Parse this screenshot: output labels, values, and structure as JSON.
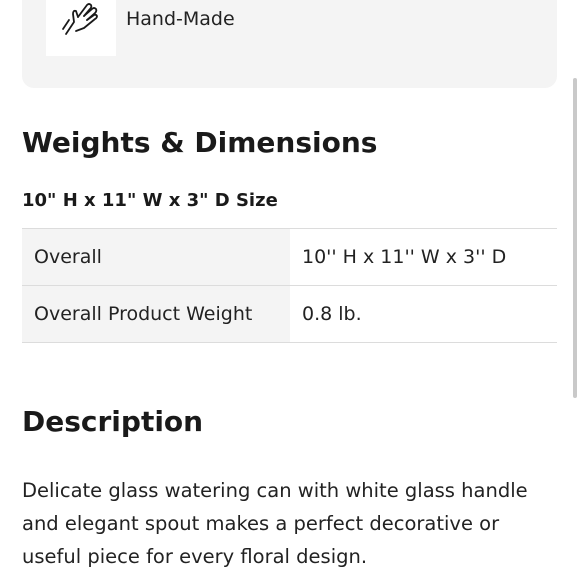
{
  "feature": {
    "icon": "hand-icon",
    "label": "Hand-Made"
  },
  "weights_dimensions": {
    "title": "Weights & Dimensions",
    "size_line": "10\" H x 11\" W x 3\" D Size",
    "rows": [
      {
        "key": "Overall",
        "value": "10'' H x 11'' W x 3'' D"
      },
      {
        "key": "Overall Product Weight",
        "value": "0.8 lb."
      }
    ]
  },
  "description": {
    "title": "Description",
    "text": "Delicate glass watering can with white glass handle and elegant spout makes a perfect decorative or useful piece for every floral design."
  },
  "colors": {
    "card_bg": "#f4f4f4",
    "text": "#222222",
    "divider": "#dcdcdc"
  }
}
